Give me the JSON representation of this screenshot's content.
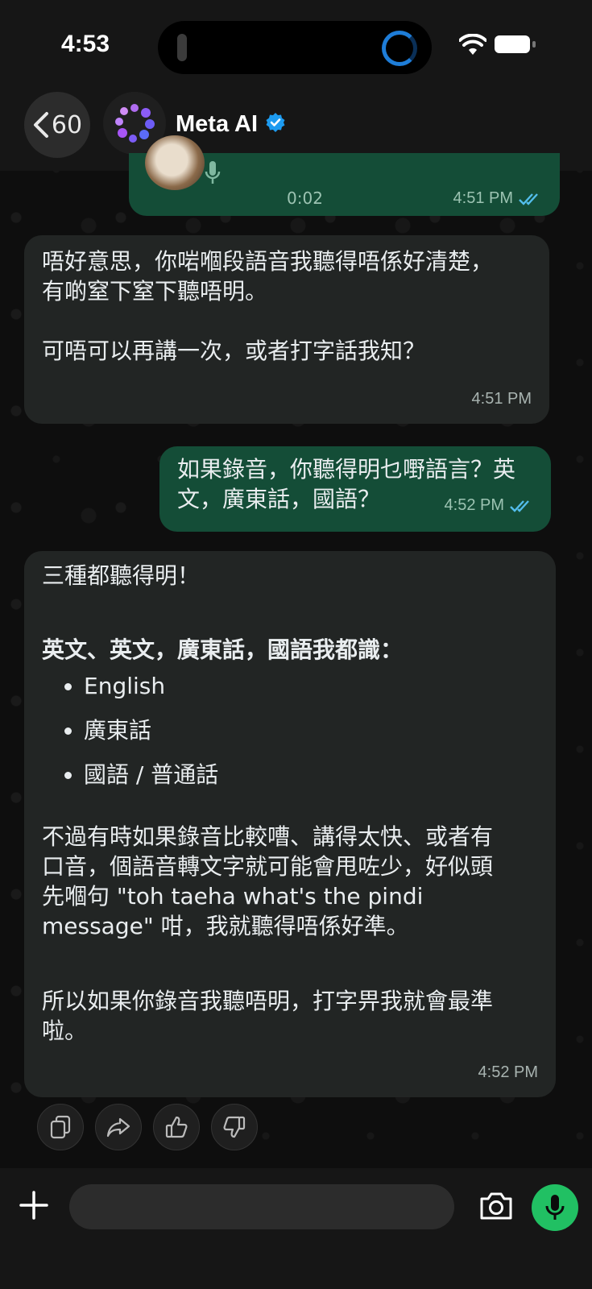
{
  "status_bar": {
    "time": "4:53"
  },
  "header": {
    "back_count": "60",
    "contact_name": "Meta AI"
  },
  "messages": {
    "voice": {
      "duration": "0:02",
      "time": "4:51 PM"
    },
    "m1": {
      "text": "唔好意思，你啱嗰段語音我聽得唔係好清楚，\n有啲窒下窒下聽唔明。\n\n可唔可以再講一次，或者打字話我知？",
      "time": "4:51 PM"
    },
    "m2": {
      "text": "如果錄音，你聽得明乜嘢語言？英\n文，廣東話，國語？",
      "time": "4:52 PM"
    },
    "m3": {
      "intro": "三種都聽得明！",
      "bold": "英文、英文，廣東話，國語我都識：",
      "bullets": [
        "English",
        "廣東話",
        "國語 / 普通話"
      ],
      "para1": "不過有時如果錄音比較嘈、講得太快、或者有\n口音，個語音轉文字就可能會甩咗少，好似頭\n先嗰句 \"toh taeha what's the pindi\nmessage\" 咁，我就聽得唔係好準。",
      "para2": "所以如果你錄音我聽唔明，打字畀我就會最準\n啦。",
      "time": "4:52 PM"
    }
  },
  "colors": {
    "outgoing": "#144d37",
    "incoming": "#222524",
    "accent": "#21c063",
    "read_ticks": "#53bdeb"
  },
  "icons": [
    "back-chevron-icon",
    "verified-badge-icon",
    "mic-icon",
    "double-check-icon",
    "copy-icon",
    "share-icon",
    "thumbs-up-icon",
    "thumbs-down-icon",
    "plus-icon",
    "camera-icon",
    "wifi-icon",
    "battery-icon"
  ]
}
